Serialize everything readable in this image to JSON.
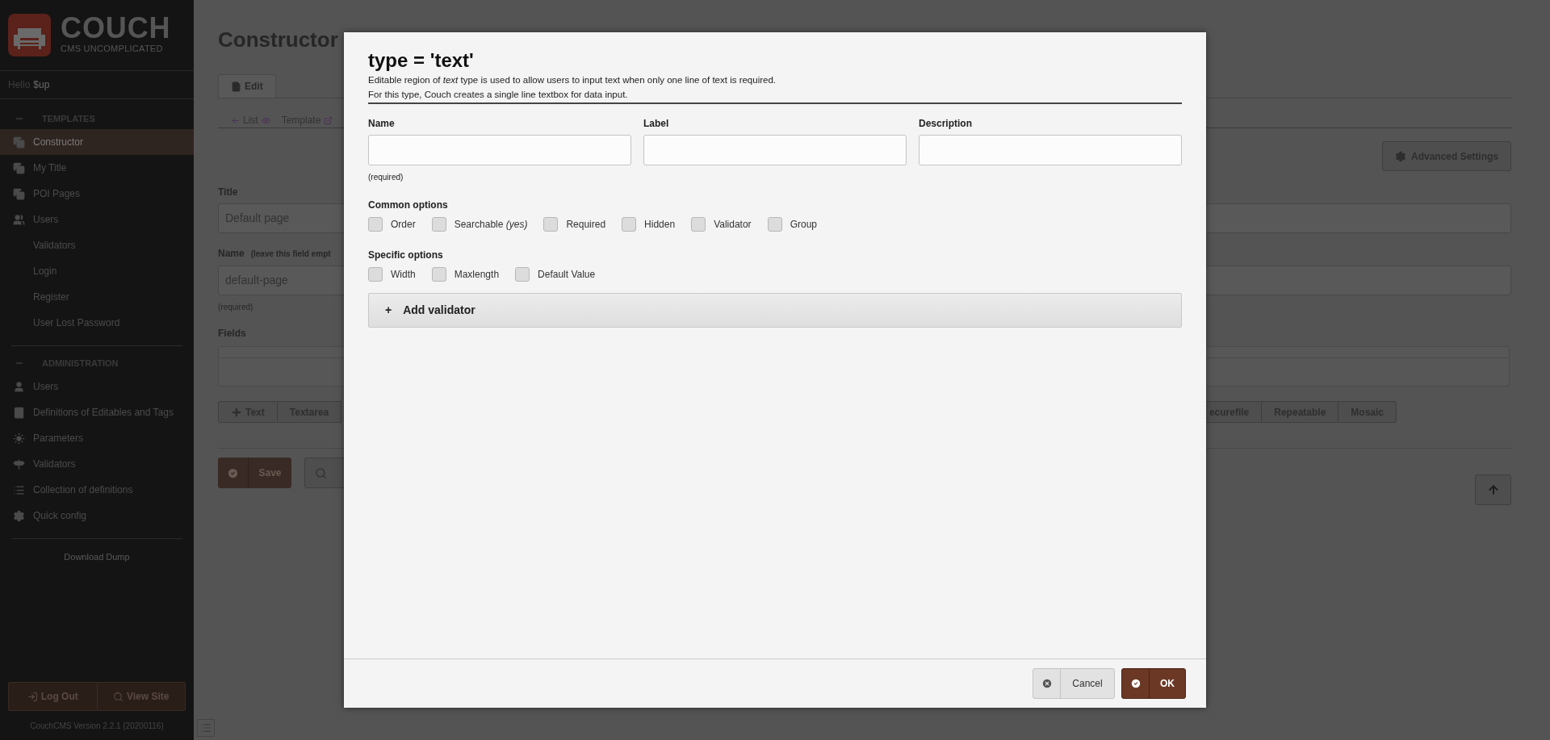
{
  "sidebar": {
    "logo": {
      "title": "COUCH",
      "subtitle": "CMS UNCOMPLICATED"
    },
    "greeting": {
      "prefix": "Hello",
      "user": "$up"
    },
    "sections": [
      {
        "title": "TEMPLATES",
        "items": [
          {
            "label": "Constructor",
            "selected": true
          },
          {
            "label": "My Title",
            "selected": false
          },
          {
            "label": "POI Pages",
            "selected": false
          },
          {
            "label": "Users",
            "selected": false
          },
          {
            "label": "Validators",
            "selected": false
          },
          {
            "label": "Login",
            "selected": false
          },
          {
            "label": "Register",
            "selected": false
          },
          {
            "label": "User Lost Password",
            "selected": false
          }
        ]
      },
      {
        "title": "ADMINISTRATION",
        "items": [
          {
            "label": "Users",
            "selected": false
          },
          {
            "label": "Definitions of Editables and Tags",
            "selected": false
          },
          {
            "label": "Parameters",
            "selected": false
          },
          {
            "label": "Validators",
            "selected": false
          },
          {
            "label": "Collection of definitions",
            "selected": false
          },
          {
            "label": "Quick config",
            "selected": false
          }
        ]
      }
    ],
    "download": "Download Dump",
    "buttons": [
      "Log Out",
      "View Site"
    ],
    "version": "CouchCMS Version 2.2.1 (20200116)"
  },
  "page": {
    "title": "Constructor",
    "tabs": [
      {
        "label": "Edit",
        "selected": true
      }
    ],
    "links": [
      "List",
      "Template"
    ],
    "advanced_button": "Advanced Settings",
    "title_label": "Title",
    "title_value": "Default page",
    "name_label": "Name",
    "name_hint": "(leave this field empt",
    "name_value": "default-page",
    "name_note": "(required)",
    "fields_label": "Fields",
    "field_buttons_left": [
      "Text",
      "Textarea"
    ],
    "field_buttons_right": [
      "ecurefile",
      "Repeatable",
      "Mosaic"
    ],
    "save": "Save"
  },
  "modal": {
    "title": "type = 'text'",
    "description": [
      "Editable region of *text* type is used to allow users to input text when only one line of text is required.",
      "For this type, Couch creates a single line textbox for data input."
    ],
    "fields": [
      {
        "label": "Name",
        "note": "(required)"
      },
      {
        "label": "Label"
      },
      {
        "label": "Description"
      }
    ],
    "option_groups": [
      {
        "title": "Common options",
        "options": [
          {
            "label": "Order",
            "checked": false
          },
          {
            "label": "Searchable *(yes)*",
            "checked": false
          },
          {
            "label": "Required",
            "checked": false
          },
          {
            "label": "Hidden",
            "checked": false
          },
          {
            "label": "Validator",
            "checked": false
          },
          {
            "label": "Group",
            "checked": false
          }
        ]
      },
      {
        "title": "Specific options",
        "options": [
          {
            "label": "Width",
            "checked": false
          },
          {
            "label": "Maxlength",
            "checked": false
          },
          {
            "label": "Default Value",
            "checked": false
          }
        ]
      }
    ],
    "add_validator": {
      "symbol": "+",
      "label": "Add validator"
    },
    "cancel": "Cancel",
    "ok": "OK"
  }
}
